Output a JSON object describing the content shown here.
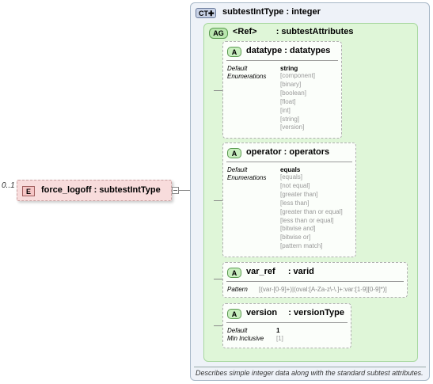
{
  "element": {
    "occurrence": "0..1",
    "badge": "E",
    "title": "force_logoff : subtestIntType"
  },
  "complex_type": {
    "badge": "CT",
    "title": "subtestIntType : integer",
    "description": "Describes simple integer data along with the standard subtest attributes."
  },
  "attribute_group": {
    "badge": "AG",
    "ref": "<Ref>",
    "name": ": subtestAttributes"
  },
  "attributes": [
    {
      "badge": "A",
      "title": "datatype : datatypes",
      "default_label": "Default",
      "default_value": "string",
      "enum_label": "Enumerations",
      "enumerations": [
        "[component]",
        "[binary]",
        "[boolean]",
        "[float]",
        "[int]",
        "[string]",
        "[version]"
      ]
    },
    {
      "badge": "A",
      "title": "operator : operators",
      "default_label": "Default",
      "default_value": "equals",
      "enum_label": "Enumerations",
      "enumerations": [
        "[equals]",
        "[not equal]",
        "[greater than]",
        "[less than]",
        "[greater than or equal]",
        "[less than or equal]",
        "[bitwise and]",
        "[bitwise or]",
        "[pattern match]"
      ]
    },
    {
      "badge": "A",
      "title_name": "var_ref",
      "title_type": ": varid",
      "pattern_label": "Pattern",
      "pattern_value": "[(var-[0-9]+)|(oval:[A-Za-z\\-\\.]+:var:[1-9][0-9]*)]"
    },
    {
      "badge": "A",
      "title_name": "version",
      "title_type": ": versionType",
      "default_label": "Default",
      "default_value": "1",
      "min_label": "Min Inclusive",
      "min_value": "[1]"
    }
  ]
}
